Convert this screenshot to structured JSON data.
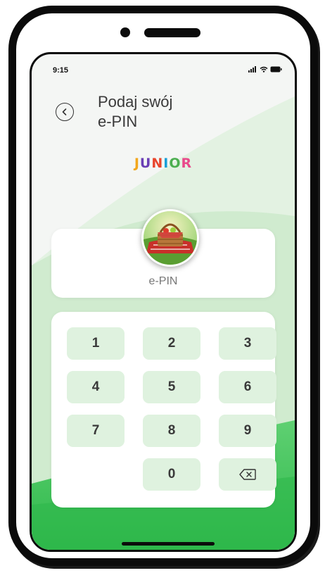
{
  "status_bar": {
    "time": "9:15",
    "icons": [
      "signal-icon",
      "wifi-icon",
      "battery-icon"
    ]
  },
  "header": {
    "back_icon": "chevron-left-icon",
    "title": "Podaj swój\ne-PIN"
  },
  "logo": {
    "text": "JUNIOR",
    "letter_colors": [
      "#f2a71b",
      "#6a3fb5",
      "#e8452c",
      "#1aa0d8",
      "#4caf50",
      "#e94a8b"
    ]
  },
  "avatar": {
    "description_icon": "picnic-basket-image"
  },
  "pin_field": {
    "label": "e-PIN"
  },
  "keypad": {
    "keys": [
      "1",
      "2",
      "3",
      "4",
      "5",
      "6",
      "7",
      "8",
      "9",
      "0"
    ],
    "delete_icon": "backspace-icon"
  },
  "colors": {
    "key_background": "#dff2df",
    "accent_green": "#3cc257",
    "light_green": "#d9efd9"
  }
}
